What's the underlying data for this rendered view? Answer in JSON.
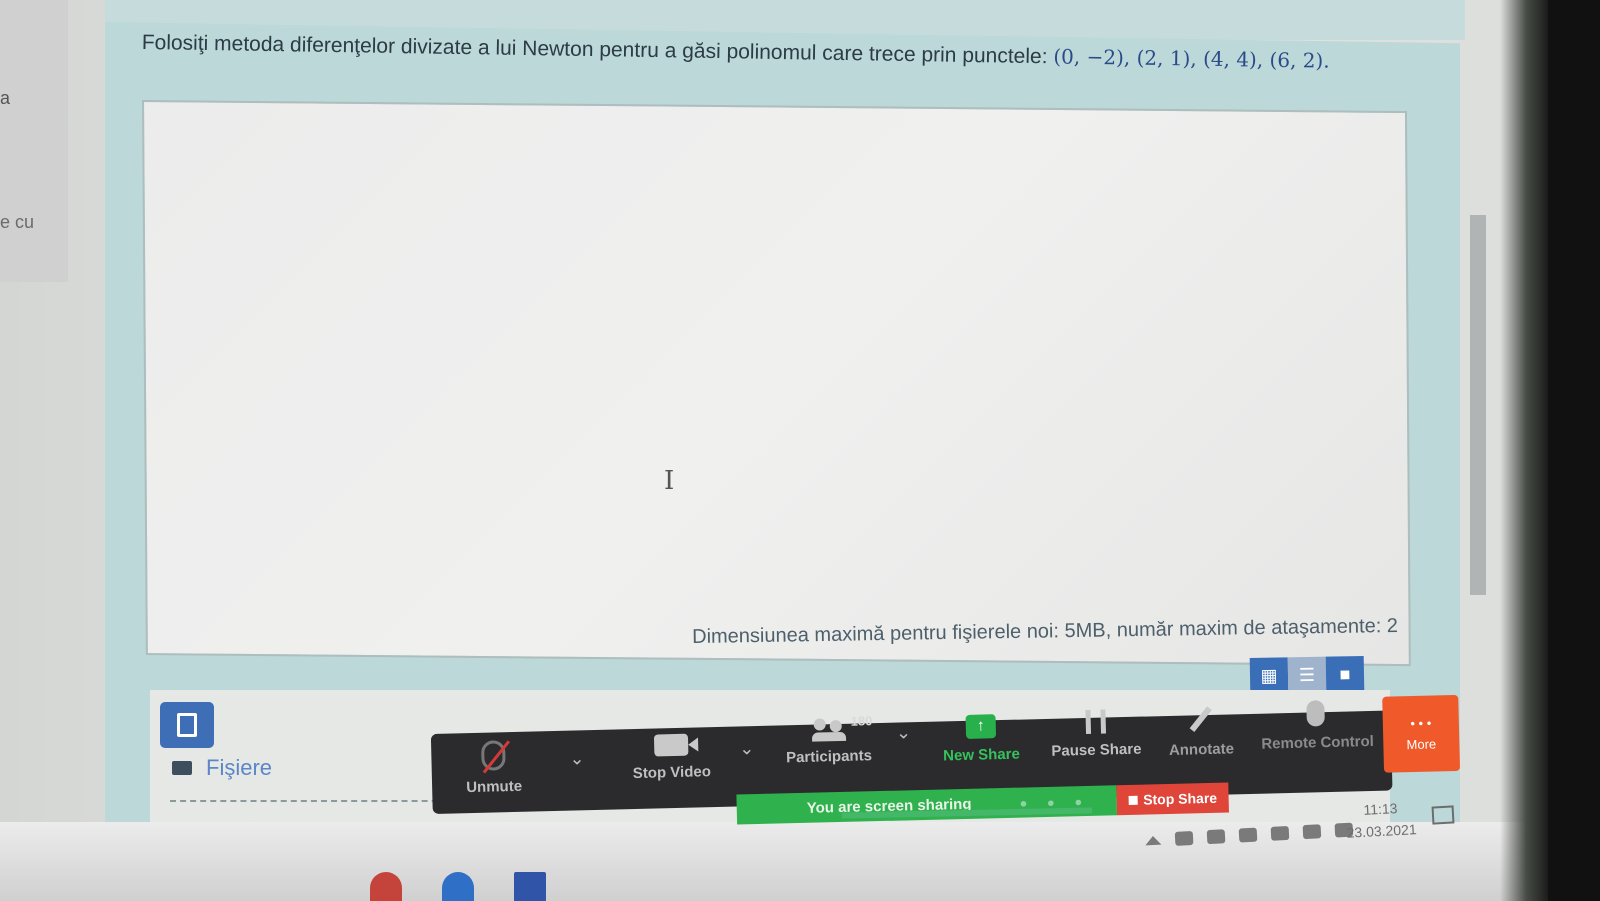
{
  "question": {
    "text": "Folosiţi metoda diferenţelor divizate a lui Newton pentru a găsi polinomul care trece prin punctele: ",
    "points": "(0, −2), (2, 1), (4, 4), (6, 2)."
  },
  "left_fragments": [
    "a",
    "e cu"
  ],
  "attachments": {
    "size_note": "Dimensiunea maximă pentru fişierele noi: 5MB, număr maxim de ataşamente: 2",
    "files_label": "Fişiere"
  },
  "zoom_toolbar": {
    "unmute": "Unmute",
    "stop_video": "Stop Video",
    "participants": "Participants",
    "participants_count": "180",
    "new_share": "New Share",
    "pause_share": "Pause Share",
    "annotate": "Annotate",
    "remote_control": "Remote Control",
    "more": "More",
    "sharing_status": "You are screen sharing",
    "stop_share": "Stop Share"
  },
  "taskbar": {
    "time": "11:13",
    "date": "23.03.2021"
  },
  "colors": {
    "accent_blue": "#3e6fb6",
    "zoom_green": "#2fb14e",
    "zoom_red": "#e0453a",
    "zoom_orange": "#f0592a"
  },
  "icons": [
    "mic-muted-icon",
    "video-icon",
    "participants-icon",
    "share-arrow-icon",
    "pause-icon",
    "pen-icon",
    "mouse-icon",
    "more-dots-icon",
    "file-icon",
    "folder-icon",
    "grid-view-icon",
    "list-view-icon"
  ]
}
